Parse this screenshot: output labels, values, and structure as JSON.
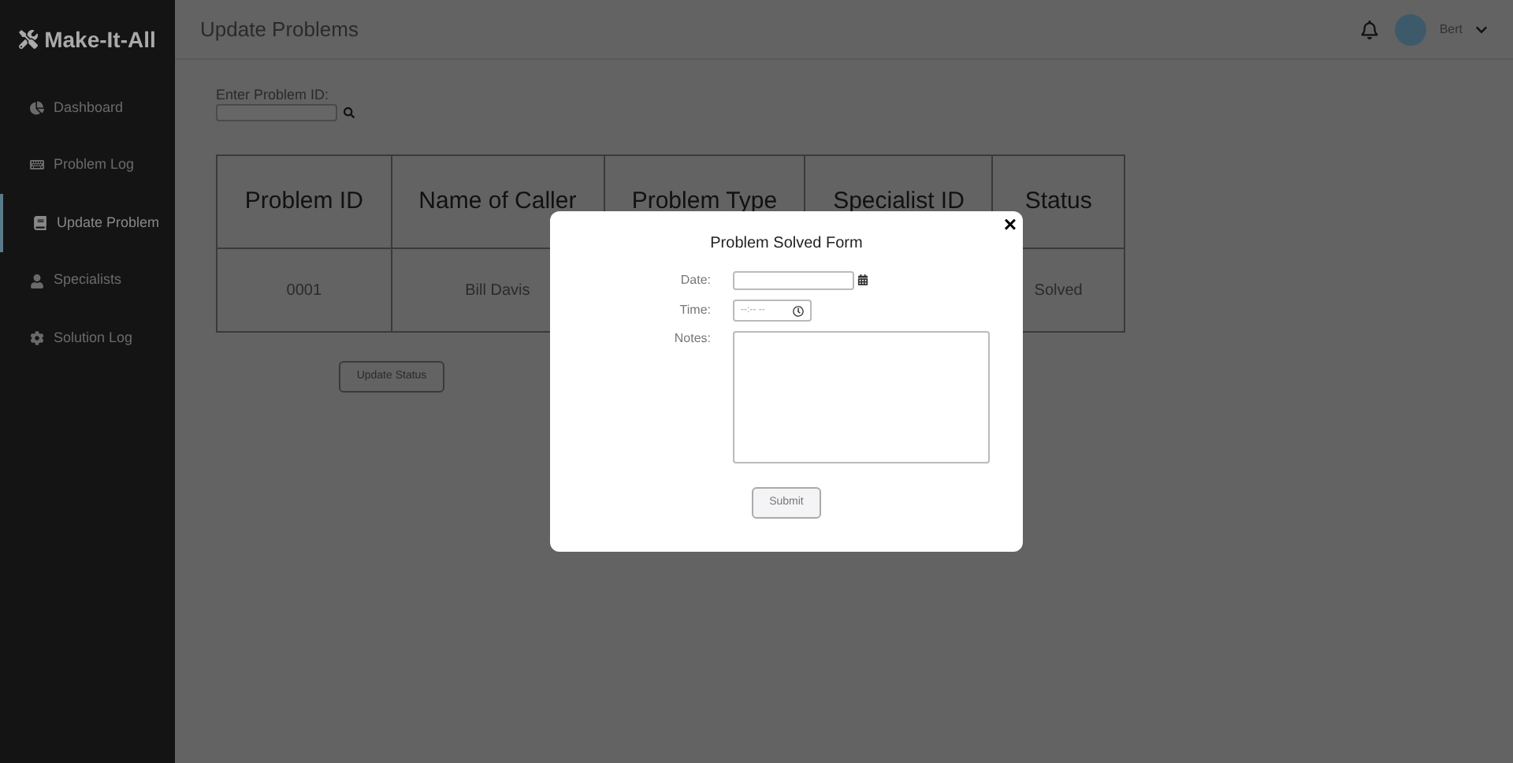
{
  "brand": "Make-It-All",
  "sidebar": {
    "items": [
      {
        "label": "Dashboard",
        "kind": "dashboard",
        "selected": false
      },
      {
        "label": "Problem Log",
        "kind": "log",
        "selected": false
      },
      {
        "label": "Update Problem",
        "kind": "book",
        "selected": true
      },
      {
        "label": "Specialists",
        "kind": "user",
        "selected": false
      },
      {
        "label": "Solution Log",
        "kind": "gear",
        "selected": false
      }
    ]
  },
  "header": {
    "title": "Update Problems",
    "user": "Bert"
  },
  "search": {
    "label": "Enter Problem ID:"
  },
  "table": {
    "columns": [
      "Problem ID",
      "Name of Caller",
      "Problem Type",
      "Specialist ID",
      "Status"
    ],
    "rows": [
      [
        "0001",
        "Bill Davis",
        null,
        null,
        "Solved"
      ]
    ]
  },
  "update_button": "Update Status",
  "modal": {
    "title": "Problem Solved Form",
    "date_label": "Date:",
    "time_label": "Time:",
    "time_placeholder": "--:-- --",
    "notes_label": "Notes:",
    "submit": "Submit",
    "close": "×"
  }
}
